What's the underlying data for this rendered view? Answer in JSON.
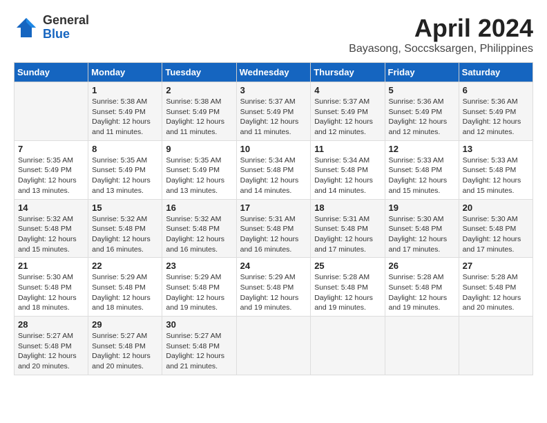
{
  "header": {
    "logo_general": "General",
    "logo_blue": "Blue",
    "title": "April 2024",
    "location": "Bayasong, Soccsksargen, Philippines"
  },
  "calendar": {
    "days_of_week": [
      "Sunday",
      "Monday",
      "Tuesday",
      "Wednesday",
      "Thursday",
      "Friday",
      "Saturday"
    ],
    "weeks": [
      [
        {
          "day": "",
          "info": ""
        },
        {
          "day": "1",
          "info": "Sunrise: 5:38 AM\nSunset: 5:49 PM\nDaylight: 12 hours\nand 11 minutes."
        },
        {
          "day": "2",
          "info": "Sunrise: 5:38 AM\nSunset: 5:49 PM\nDaylight: 12 hours\nand 11 minutes."
        },
        {
          "day": "3",
          "info": "Sunrise: 5:37 AM\nSunset: 5:49 PM\nDaylight: 12 hours\nand 11 minutes."
        },
        {
          "day": "4",
          "info": "Sunrise: 5:37 AM\nSunset: 5:49 PM\nDaylight: 12 hours\nand 12 minutes."
        },
        {
          "day": "5",
          "info": "Sunrise: 5:36 AM\nSunset: 5:49 PM\nDaylight: 12 hours\nand 12 minutes."
        },
        {
          "day": "6",
          "info": "Sunrise: 5:36 AM\nSunset: 5:49 PM\nDaylight: 12 hours\nand 12 minutes."
        }
      ],
      [
        {
          "day": "7",
          "info": "Sunrise: 5:35 AM\nSunset: 5:49 PM\nDaylight: 12 hours\nand 13 minutes."
        },
        {
          "day": "8",
          "info": "Sunrise: 5:35 AM\nSunset: 5:49 PM\nDaylight: 12 hours\nand 13 minutes."
        },
        {
          "day": "9",
          "info": "Sunrise: 5:35 AM\nSunset: 5:49 PM\nDaylight: 12 hours\nand 13 minutes."
        },
        {
          "day": "10",
          "info": "Sunrise: 5:34 AM\nSunset: 5:48 PM\nDaylight: 12 hours\nand 14 minutes."
        },
        {
          "day": "11",
          "info": "Sunrise: 5:34 AM\nSunset: 5:48 PM\nDaylight: 12 hours\nand 14 minutes."
        },
        {
          "day": "12",
          "info": "Sunrise: 5:33 AM\nSunset: 5:48 PM\nDaylight: 12 hours\nand 15 minutes."
        },
        {
          "day": "13",
          "info": "Sunrise: 5:33 AM\nSunset: 5:48 PM\nDaylight: 12 hours\nand 15 minutes."
        }
      ],
      [
        {
          "day": "14",
          "info": "Sunrise: 5:32 AM\nSunset: 5:48 PM\nDaylight: 12 hours\nand 15 minutes."
        },
        {
          "day": "15",
          "info": "Sunrise: 5:32 AM\nSunset: 5:48 PM\nDaylight: 12 hours\nand 16 minutes."
        },
        {
          "day": "16",
          "info": "Sunrise: 5:32 AM\nSunset: 5:48 PM\nDaylight: 12 hours\nand 16 minutes."
        },
        {
          "day": "17",
          "info": "Sunrise: 5:31 AM\nSunset: 5:48 PM\nDaylight: 12 hours\nand 16 minutes."
        },
        {
          "day": "18",
          "info": "Sunrise: 5:31 AM\nSunset: 5:48 PM\nDaylight: 12 hours\nand 17 minutes."
        },
        {
          "day": "19",
          "info": "Sunrise: 5:30 AM\nSunset: 5:48 PM\nDaylight: 12 hours\nand 17 minutes."
        },
        {
          "day": "20",
          "info": "Sunrise: 5:30 AM\nSunset: 5:48 PM\nDaylight: 12 hours\nand 17 minutes."
        }
      ],
      [
        {
          "day": "21",
          "info": "Sunrise: 5:30 AM\nSunset: 5:48 PM\nDaylight: 12 hours\nand 18 minutes."
        },
        {
          "day": "22",
          "info": "Sunrise: 5:29 AM\nSunset: 5:48 PM\nDaylight: 12 hours\nand 18 minutes."
        },
        {
          "day": "23",
          "info": "Sunrise: 5:29 AM\nSunset: 5:48 PM\nDaylight: 12 hours\nand 19 minutes."
        },
        {
          "day": "24",
          "info": "Sunrise: 5:29 AM\nSunset: 5:48 PM\nDaylight: 12 hours\nand 19 minutes."
        },
        {
          "day": "25",
          "info": "Sunrise: 5:28 AM\nSunset: 5:48 PM\nDaylight: 12 hours\nand 19 minutes."
        },
        {
          "day": "26",
          "info": "Sunrise: 5:28 AM\nSunset: 5:48 PM\nDaylight: 12 hours\nand 19 minutes."
        },
        {
          "day": "27",
          "info": "Sunrise: 5:28 AM\nSunset: 5:48 PM\nDaylight: 12 hours\nand 20 minutes."
        }
      ],
      [
        {
          "day": "28",
          "info": "Sunrise: 5:27 AM\nSunset: 5:48 PM\nDaylight: 12 hours\nand 20 minutes."
        },
        {
          "day": "29",
          "info": "Sunrise: 5:27 AM\nSunset: 5:48 PM\nDaylight: 12 hours\nand 20 minutes."
        },
        {
          "day": "30",
          "info": "Sunrise: 5:27 AM\nSunset: 5:48 PM\nDaylight: 12 hours\nand 21 minutes."
        },
        {
          "day": "",
          "info": ""
        },
        {
          "day": "",
          "info": ""
        },
        {
          "day": "",
          "info": ""
        },
        {
          "day": "",
          "info": ""
        }
      ]
    ]
  }
}
